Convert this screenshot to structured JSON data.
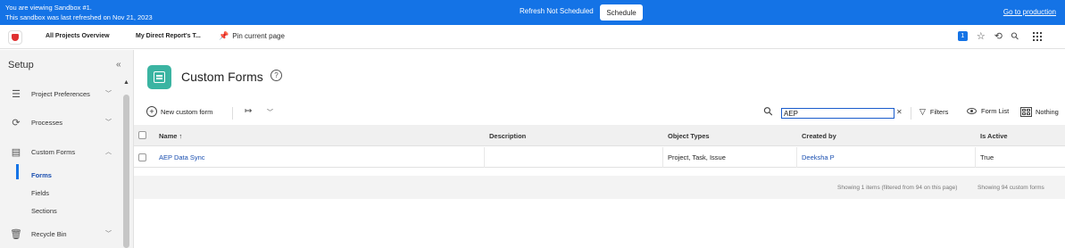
{
  "banner": {
    "line1": "You are viewing Sandbox #1.",
    "line2": "This sandbox was last refreshed on Nov 21, 2023",
    "status": "Refresh Not Scheduled",
    "schedule_label": "Schedule",
    "production_link": "Go to production"
  },
  "topnav": {
    "tab1": "All Projects Overview",
    "tab2": "My Direct Report's T...",
    "pin_label": "Pin current page",
    "notification_count": "1",
    "brand_color": "#e03131"
  },
  "sidebar": {
    "title": "Setup",
    "collapse": "«",
    "items": [
      {
        "label": "Project Preferences",
        "icon": "sliders-icon",
        "expanded": false
      },
      {
        "label": "Processes",
        "icon": "process-icon",
        "expanded": false
      },
      {
        "label": "Custom Forms",
        "icon": "form-icon",
        "expanded": true
      },
      {
        "label": "Recycle Bin",
        "icon": "trash-icon",
        "expanded": false
      }
    ],
    "sub_items": [
      "Forms",
      "Fields",
      "Sections"
    ],
    "active_sub": "Forms"
  },
  "main": {
    "title": "Custom Forms",
    "toolbar": {
      "new_label": "New custom form",
      "search_value": "AEP",
      "filters_label": "Filters",
      "formlist_label": "Form List",
      "grouping_label": "Nothing"
    },
    "table": {
      "columns": [
        "Name ↑",
        "Description",
        "Object Types",
        "Created by",
        "Is Active"
      ],
      "rows": [
        {
          "name": "AEP Data Sync",
          "description": "",
          "object_types": "Project, Task, Issue",
          "created_by": "Deeksha P",
          "is_active": "True"
        }
      ]
    },
    "footer": {
      "showing": "Showing 1 items (filtered from 94 on this page)",
      "total": "Showing 94 custom forms"
    }
  },
  "colors": {
    "banner": "#1473e6",
    "accent": "#1473e6",
    "page_icon": "#3bb4a2",
    "link": "#1a4fb0"
  }
}
